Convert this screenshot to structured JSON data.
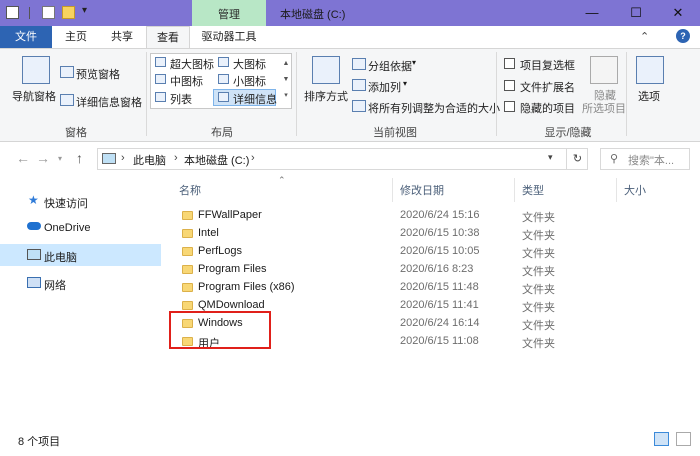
{
  "window": {
    "title": "本地磁盘 (C:)",
    "context_tab": "管理",
    "controls": [
      "—",
      "☐",
      "✕"
    ]
  },
  "ribbon_tabs": {
    "file": "文件",
    "home": "主页",
    "share": "共享",
    "view": "查看",
    "drive_tools": "驱动器工具"
  },
  "ribbon": {
    "panes": {
      "nav_pane": "导航窗格",
      "preview_pane": "预览窗格",
      "details_pane": "详细信息窗格",
      "group_label": "窗格"
    },
    "layout": {
      "extra_large": "超大图标",
      "large": "大图标",
      "medium": "中图标",
      "small": "小图标",
      "list": "列表",
      "details": "详细信息",
      "group_label": "布局"
    },
    "current_view": {
      "sort_by": "排序方式",
      "group_by": "分组依据",
      "add_columns": "添加列",
      "fit_columns": "将所有列调整为合适的大小",
      "group_label": "当前视图"
    },
    "show_hide": {
      "item_checkboxes": "项目复选框",
      "file_extensions": "文件扩展名",
      "hidden_items": "隐藏的项目",
      "hide_selected_1": "隐藏",
      "hide_selected_2": "所选项目",
      "group_label": "显示/隐藏"
    },
    "options": "选项"
  },
  "address": {
    "crumbs": [
      "此电脑",
      "本地磁盘 (C:)"
    ],
    "search_placeholder": "搜索\"本..."
  },
  "nav_pane": {
    "items": [
      {
        "label": "快速访问",
        "icon": "star-icon"
      },
      {
        "label": "OneDrive",
        "icon": "cloud-icon"
      },
      {
        "label": "此电脑",
        "icon": "computer-icon",
        "selected": true
      },
      {
        "label": "网络",
        "icon": "network-icon"
      }
    ]
  },
  "columns": {
    "name": "名称",
    "date": "修改日期",
    "type": "类型",
    "size": "大小"
  },
  "files": [
    {
      "name": "FFWallPaper",
      "date": "2020/6/24 15:16",
      "type": "文件夹"
    },
    {
      "name": "Intel",
      "date": "2020/6/15 10:38",
      "type": "文件夹"
    },
    {
      "name": "PerfLogs",
      "date": "2020/6/15 10:05",
      "type": "文件夹"
    },
    {
      "name": "Program Files",
      "date": "2020/6/16 8:23",
      "type": "文件夹"
    },
    {
      "name": "Program Files (x86)",
      "date": "2020/6/15 11:48",
      "type": "文件夹"
    },
    {
      "name": "QMDownload",
      "date": "2020/6/15 11:41",
      "type": "文件夹"
    },
    {
      "name": "Windows",
      "date": "2020/6/24 16:14",
      "type": "文件夹"
    },
    {
      "name": "用户",
      "date": "2020/6/15 11:08",
      "type": "文件夹"
    }
  ],
  "status": {
    "count": "8 个项目"
  },
  "colors": {
    "titlebar": "#7e74d3",
    "manage_tab": "#b8e7c6",
    "file_tab": "#2d64b3",
    "selection": "#cce8ff",
    "highlight": "#e0201a",
    "folder": "#f8d775"
  }
}
